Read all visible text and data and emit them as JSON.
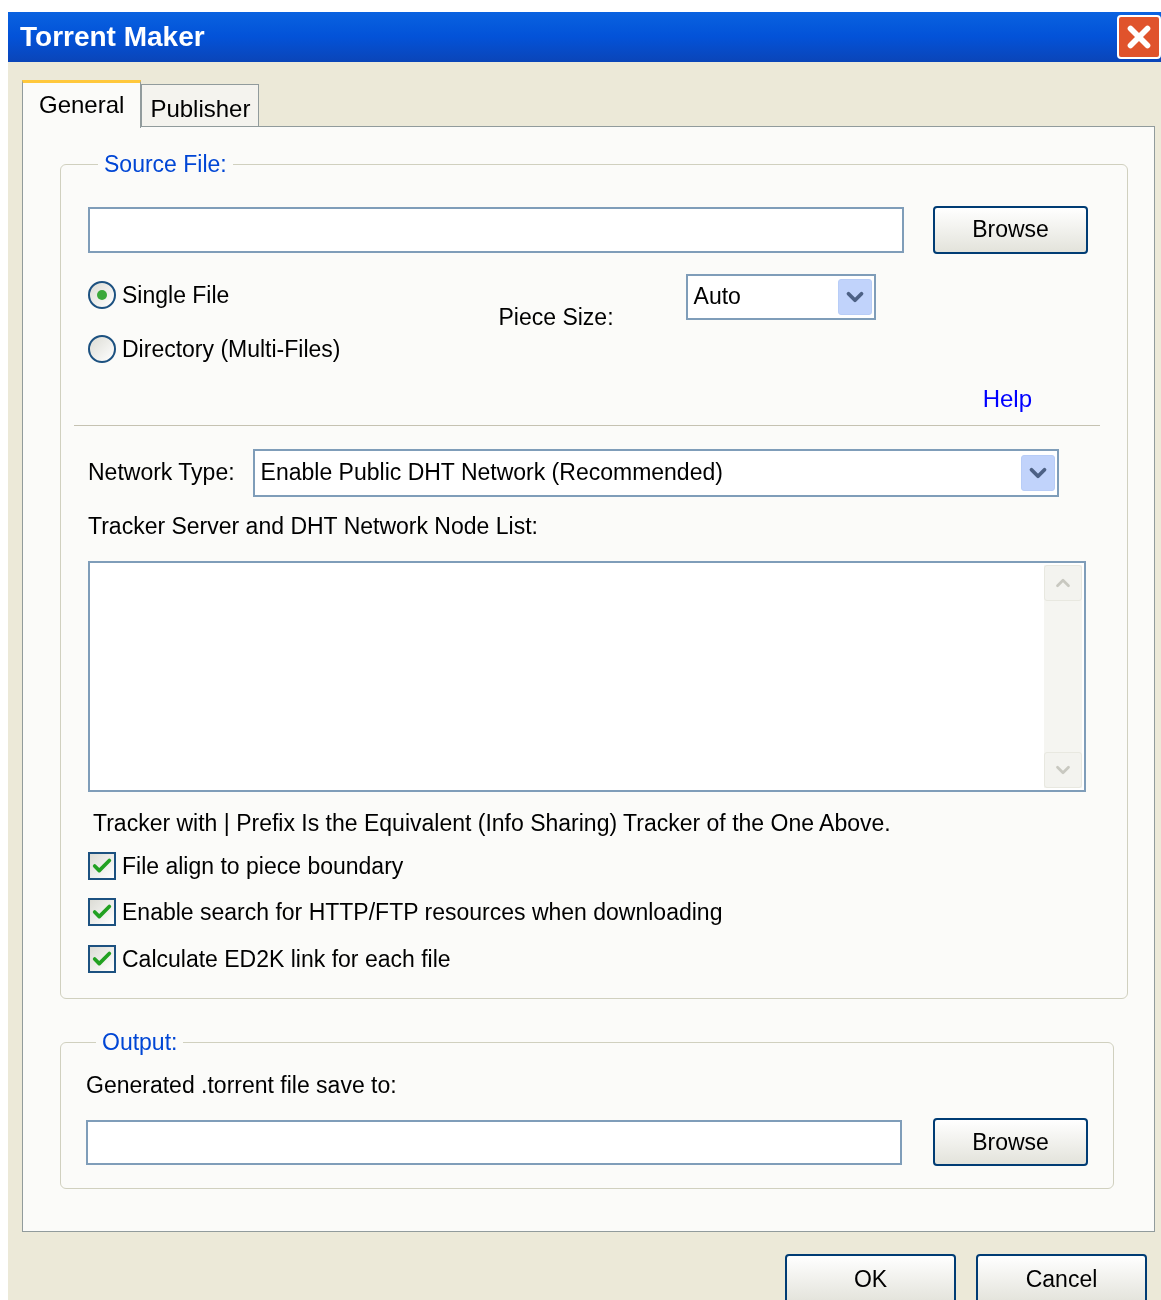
{
  "window": {
    "title": "Torrent Maker"
  },
  "tabs": [
    {
      "label": "General",
      "selected": true
    },
    {
      "label": "Publisher",
      "selected": false
    }
  ],
  "source_file": {
    "legend": "Source File:",
    "browse_button": "Browse",
    "file_type": [
      {
        "label": "Single File",
        "selected": true
      },
      {
        "label": "Directory (Multi-Files)",
        "selected": false
      }
    ],
    "piece_size": {
      "label": "Piece Size:",
      "value": "Auto"
    },
    "help_link": "Help",
    "network_type": {
      "label": "Network Type:",
      "value": "Enable Public DHT Network (Recommended)"
    },
    "node_list": {
      "label": "Tracker Server and DHT Network Node List:"
    },
    "note": "Tracker with | Prefix Is the Equivalent (Info Sharing) Tracker of the One Above.",
    "options": [
      {
        "label": "File align to piece boundary",
        "checked": true
      },
      {
        "label": "Enable search for HTTP/FTP resources when downloading",
        "checked": true
      },
      {
        "label": "Calculate ED2K link for each file",
        "checked": true
      }
    ]
  },
  "output": {
    "legend": "Output:",
    "label": "Generated .torrent file save to:",
    "browse_button": "Browse"
  },
  "buttons": [
    "OK",
    "Cancel"
  ]
}
